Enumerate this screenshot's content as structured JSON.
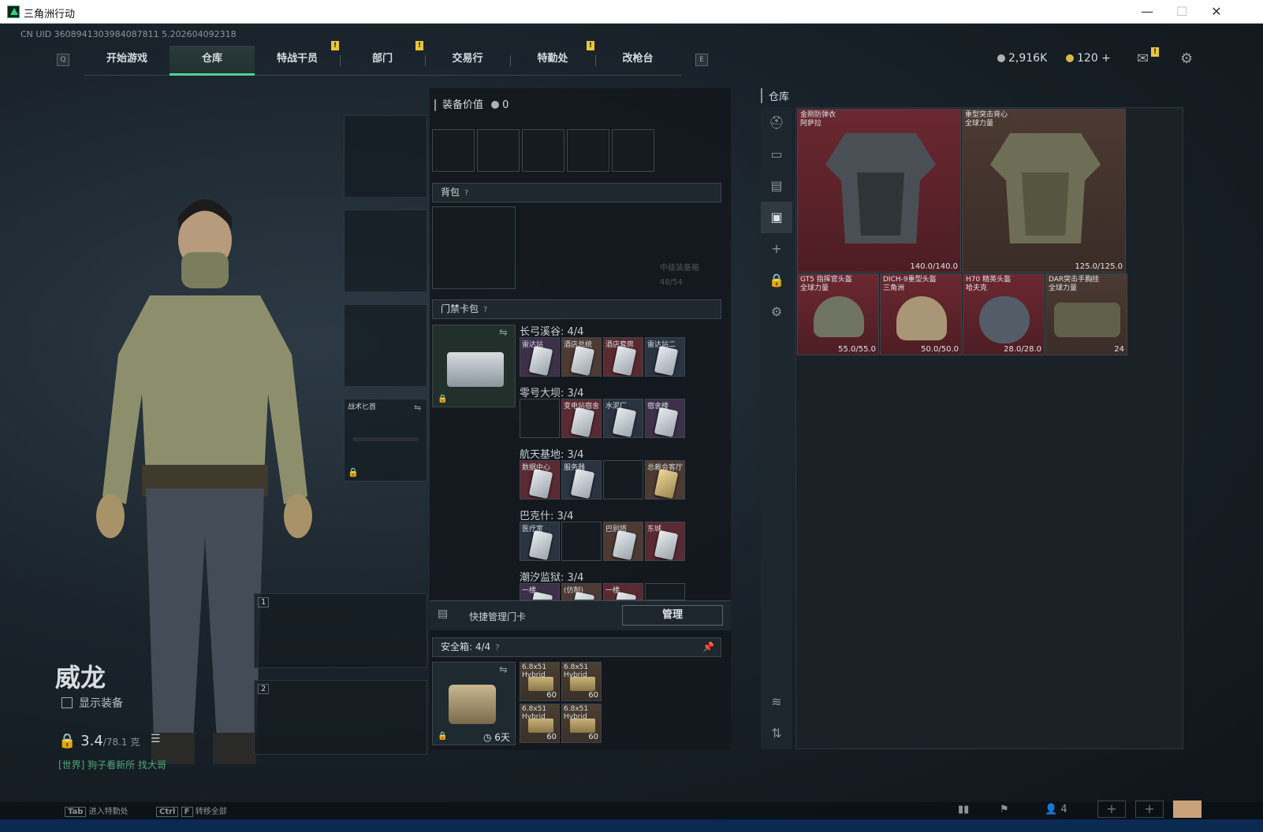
{
  "window": {
    "title": "三角洲行动"
  },
  "uid": "CN UID 3608941303984087811 5.202604092318",
  "nav": {
    "left_key": "Q",
    "right_key": "E",
    "tabs": [
      "开始游戏",
      "仓库",
      "特战干员",
      "部门",
      "交易行",
      "特勤处",
      "改枪台"
    ],
    "active": "仓库"
  },
  "currency": {
    "silver": "2,916K",
    "gold": "120 +"
  },
  "character": {
    "name": "威龙",
    "show_equip": "显示装备",
    "weight": "3.4",
    "weight_max": "/78.1 克",
    "chat": "[世界] 狗子看新所  找大哥",
    "melee_label": "战术匕首",
    "slot1": "1",
    "slot2": "2"
  },
  "bottom": {
    "tab_key": "Tab",
    "tab_label": "进入特勤处",
    "ctrl_key": "Ctrl",
    "f_key": "F",
    "ctrl_label": "转移全部",
    "team_count": "4"
  },
  "middle": {
    "equip_value_label": "装备价值",
    "equip_value": "0",
    "backpack": "背包",
    "backpack_hint_1": "中级装备箱",
    "backpack_hint_2": "48/54",
    "keycard_bag": "门禁卡包",
    "keycard_groups": [
      {
        "label": "长弓溪谷: 4/4",
        "cards": [
          "雷达站",
          "酒店总统",
          "酒店套房",
          "雷达站二"
        ]
      },
      {
        "label": "零号大坝: 3/4",
        "cards": [
          "",
          "变电站宿舍",
          "水泥厂",
          "宿舍楼"
        ]
      },
      {
        "label": "航天基地: 3/4",
        "cards": [
          "数据中心",
          "服务器",
          "",
          "总裁会客厅"
        ]
      },
      {
        "label": "巴克什: 3/4",
        "cards": [
          "医疗室",
          "",
          "巴别塔",
          "东城"
        ]
      },
      {
        "label": "潮汐监狱: 3/4",
        "cards": [
          "一楼",
          "(仿制)",
          "一楼",
          ""
        ]
      }
    ],
    "quick_manage": "快捷管理门卡",
    "manage_btn": "管理",
    "safebox": "安全箱:",
    "safebox_count": "4/4",
    "safebox_timer": "6天",
    "ammo": [
      {
        "name": "6.8x51 Hybrid",
        "count": "60"
      },
      {
        "name": "6.8x51 Hybrid",
        "count": "60"
      },
      {
        "name": "6.8x51 Hybrid",
        "count": "60"
      },
      {
        "name": "6.8x51 Hybrid",
        "count": "60"
      }
    ]
  },
  "warehouse": {
    "title": "仓库",
    "items": [
      {
        "name": "金刚防弹衣",
        "sub": "阿萨拉",
        "dur": "140.0/140.0"
      },
      {
        "name": "重型突击背心",
        "sub": "全球力量",
        "dur": "125.0/125.0"
      },
      {
        "name": "GT5 指挥官头盔",
        "sub": "全球力量",
        "dur": "55.0/55.0"
      },
      {
        "name": "DICH-9重型头盔",
        "sub": "三角洲",
        "dur": "50.0/50.0"
      },
      {
        "name": "H70 精英头盔",
        "sub": "哈夫克",
        "dur": "28.0/28.0"
      },
      {
        "name": "DAR突击手胸挂",
        "sub": "全球力量",
        "dur": "24"
      }
    ]
  },
  "colors": {
    "accent": "#4fd1a0",
    "red_quality": "#6b2830",
    "gold_badge": "#e8c53a"
  }
}
